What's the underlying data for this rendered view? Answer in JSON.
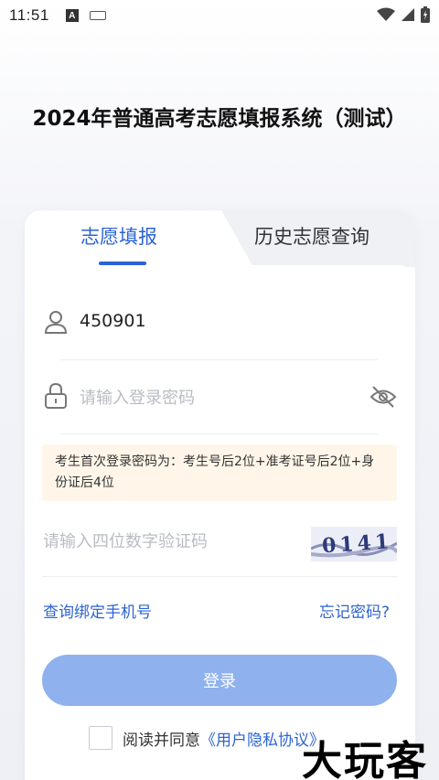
{
  "status_bar": {
    "time": "11:51",
    "a_icon_text": "A"
  },
  "app": {
    "title": "2024年普通高考志愿填报系统（测试）"
  },
  "tabs": [
    {
      "label": "志愿填报",
      "active": true
    },
    {
      "label": "历史志愿查询",
      "active": false
    }
  ],
  "form": {
    "username_value": "450901",
    "password_placeholder": "请输入登录密码",
    "notice": "考生首次登录密码为：考生号后2位+准考证号后2位+身份证后4位",
    "captcha_placeholder": "请输入四位数字验证码",
    "captcha_image_text": "0141"
  },
  "links": {
    "bind_phone": "查询绑定手机号",
    "forgot_password": "忘记密码?"
  },
  "login_button": "登录",
  "agreement": {
    "prefix": "阅读并同意",
    "link": "《用户隐私协议》",
    "checked": false
  },
  "watermark": "大玩客",
  "colors": {
    "accent": "#2d64d2",
    "button_disabled": "#8fb1ee",
    "notice_bg": "#fff6e9"
  }
}
